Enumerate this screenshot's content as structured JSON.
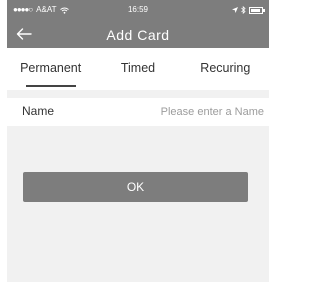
{
  "status_bar": {
    "carrier": "A&AT",
    "time": "16:59"
  },
  "header": {
    "title": "Add Card"
  },
  "tabs": [
    {
      "label": "Permanent",
      "active": true
    },
    {
      "label": "Timed",
      "active": false
    },
    {
      "label": "Recuring",
      "active": false
    }
  ],
  "form": {
    "name_label": "Name",
    "name_placeholder": "Please enter a Name",
    "name_value": ""
  },
  "actions": {
    "ok_label": "OK"
  },
  "colors": {
    "header_bg": "#7d7d7d",
    "button_bg": "#7d7d7d",
    "page_bg": "#f1f1f1",
    "tab_underline": "#444444"
  }
}
